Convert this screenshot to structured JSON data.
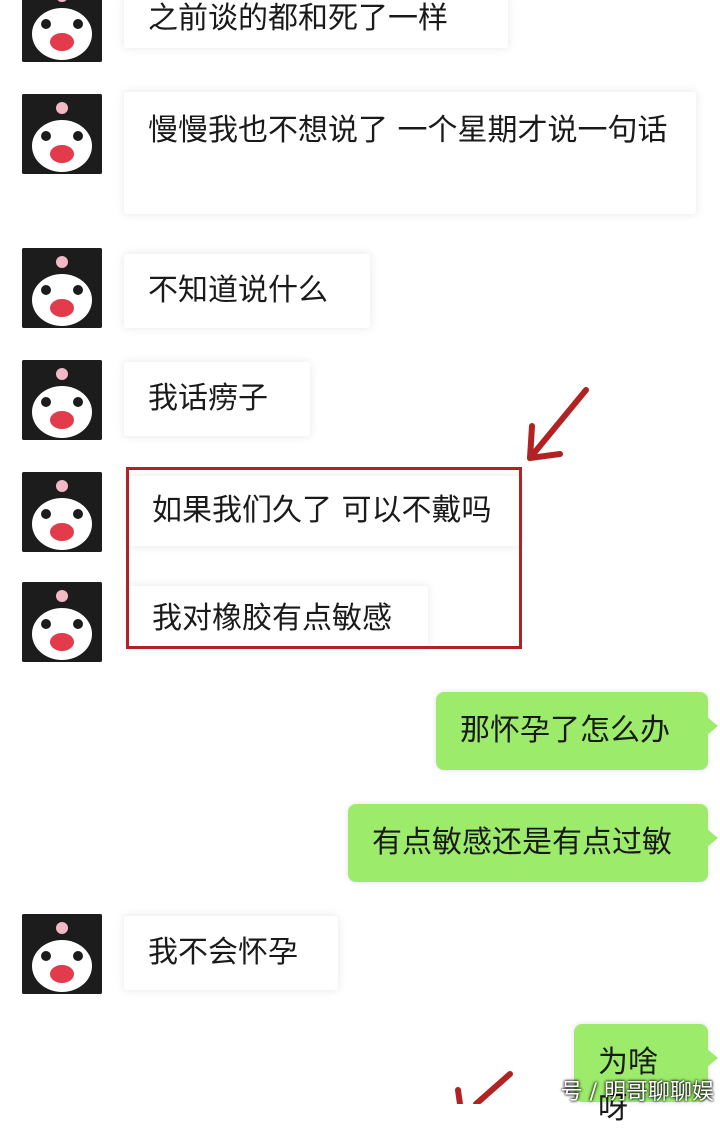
{
  "messages": [
    {
      "side": "in",
      "text": "之前谈的都和死了一样"
    },
    {
      "side": "in",
      "text": "慢慢我也不想说了 一个星期才说一句话"
    },
    {
      "side": "in",
      "text": "不知道说什么"
    },
    {
      "side": "in",
      "text": "我话痨子"
    },
    {
      "side": "in",
      "text": "如果我们久了 可以不戴吗"
    },
    {
      "side": "in",
      "text": "我对橡胶有点敏感"
    },
    {
      "side": "out",
      "text": "那怀孕了怎么办"
    },
    {
      "side": "out",
      "text": "有点敏感还是有点过敏"
    },
    {
      "side": "in",
      "text": "我不会怀孕"
    },
    {
      "side": "out",
      "text": "为啥呀"
    }
  ],
  "watermark": "号 / 明哥聊聊娱",
  "colors": {
    "outgoing_bubble": "#9ceb6a",
    "incoming_bubble": "#ffffff",
    "annotation_red": "#b22222"
  },
  "annotations": [
    "red-box-around-messages-5-6",
    "red-arrow-icon"
  ]
}
